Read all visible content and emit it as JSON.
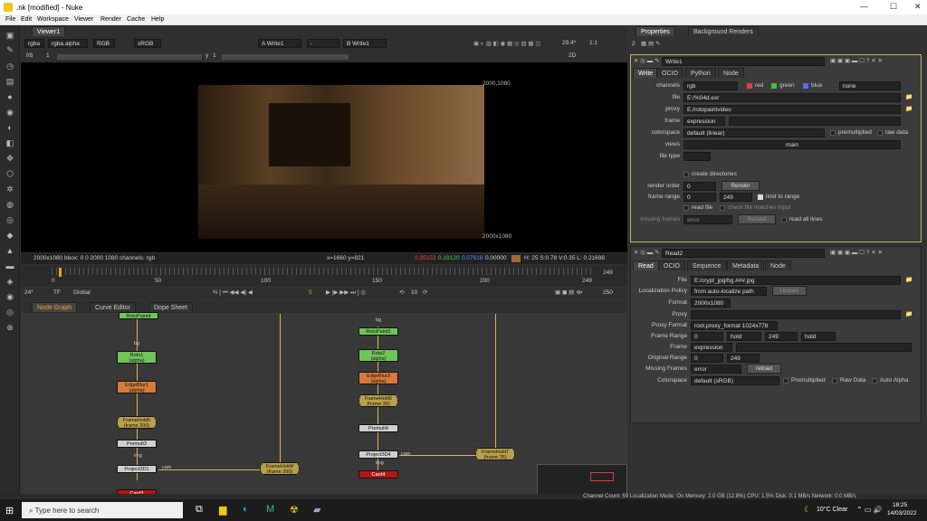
{
  "title": ".nk [modified] - Nuke",
  "menu": [
    "File",
    "Edit",
    "Workspace",
    "Viewer",
    "Render",
    "Cache",
    "Help"
  ],
  "viewer": {
    "tab": "Viewer1",
    "channel": "rgba",
    "alpha": "rgba.alpha",
    "mode": "RGB",
    "lut": "sRGB",
    "inputA": "A  Write1",
    "inputA_op": "-",
    "inputB": "B  Write1",
    "zoom": "29.4*",
    "ratio": "1:1",
    "dim": "2D",
    "fstop": "f/8",
    "frame": "1",
    "y_label": "y",
    "y_val": "1",
    "res_label": "2000,1080",
    "res_label2": "2000x1080",
    "info": "2000x1080  bbox: 0 0 2000 1080 channels: rgb",
    "coords": "x=1660 y=821",
    "r": "0.35153",
    "g": "0.19120",
    "b": "0.07618",
    "a": "0.00000",
    "hsvl": "H: 25 S:0.78 V:0.35  L: 0.21698"
  },
  "timeline": {
    "ticks": [
      "0",
      "50",
      "100",
      "150",
      "200",
      "249"
    ],
    "fps": "24*",
    "tf": "TF",
    "range": "Global",
    "frame": "5",
    "step": "10",
    "end": "250",
    "end_tick": "249"
  },
  "nodegraph": {
    "tabs": [
      "Node Graph",
      "Curve Editor",
      "Dope Sheet"
    ]
  },
  "nodes": {
    "n1": "Roto1\n(alpha)",
    "n2": "EdgeBlur1\n(alpha)",
    "n3": "FrameHold5\n(frame 200)",
    "n4": "Premult3",
    "n5": "Project3D1",
    "n6": "Card3",
    "n7": "RotoPaint5",
    "n8": "Roto2\n(alpha)",
    "n9": "EdgeBlur3\n(alpha)",
    "n10": "FrameHold6\n(frame 35)",
    "n11": "Premult4",
    "n12": "Project3D4",
    "n13": "Card4",
    "n14": "FrameHold4\n(frame 200)",
    "n15": "FrameHold7\n(frame 35)",
    "n16": "RotoPaint4",
    "bg": "bg",
    "img": "img",
    "cam": "cam",
    "img2": "img"
  },
  "properties": {
    "tabs": [
      "Properties",
      "Background Renders"
    ],
    "count": "2",
    "write": {
      "name": "Write1",
      "tabs": [
        "Write",
        "OCIO",
        "Python",
        "Node"
      ],
      "channels_label": "channels",
      "channels": "rgb",
      "red": "red",
      "green": "green",
      "blue": "blue",
      "none": "none",
      "file_label": "file",
      "file": "E:/%04d.exr",
      "proxy_label": "proxy",
      "proxy": "E:/rotopaintvideo",
      "frame_label": "frame",
      "frame": "expression",
      "colorspace_label": "colorspace",
      "colorspace": "default (linear)",
      "premultiplied": "premultiplied",
      "raw": "raw data",
      "views_label": "views",
      "views": "main",
      "filetype_label": "file type",
      "create_dirs": "create directories",
      "render_order_label": "render order",
      "render_order": "0",
      "render_btn": "Render",
      "frame_range_label": "frame range",
      "fr_start": "0",
      "fr_end": "249",
      "limit": "limit to range",
      "read_file": "read file",
      "check_file": "check file matches input",
      "missing_label": "missing frames",
      "missing": "error",
      "reload": "Reload",
      "read_all": "read all lines"
    },
    "read": {
      "name": "Read2",
      "tabs": [
        "Read",
        "OCIO",
        "Sequence",
        "Metadata",
        "Node"
      ],
      "file_label": "File",
      "file": "E:/crypt_jpg/bg.###.jpg",
      "loc_label": "Localization Policy",
      "loc": "from auto-localize path",
      "update": "Update",
      "format_label": "Format",
      "format": "2000x1080",
      "proxy_label": "Proxy",
      "proxyfmt_label": "Proxy Format",
      "proxyfmt": "root.proxy_format 1024x778",
      "range_label": "Frame Range",
      "r_start": "0",
      "r_hold1": "hold",
      "r_end": "249",
      "r_hold2": "hold",
      "frame_label": "Frame",
      "frame": "expression",
      "orig_label": "Original Range",
      "o_start": "0",
      "o_end": "249",
      "missing_label": "Missing Frames",
      "missing": "error",
      "reload": "reload",
      "cs_label": "Colorspace",
      "cs": "default (sRGB)",
      "premult": "Premultiplied",
      "raw": "Raw Data",
      "auto": "Auto Alpha"
    }
  },
  "status": "Channel Count: 59  Localization Mode: On  Memory: 2.0 GB (12.8%)  CPU: 1.5%  Disk: 0.1 MB/s  Network: 0.0 MB/s",
  "taskbar": {
    "search": "Type here to search",
    "weather": "10°C  Clear",
    "time": "18:25",
    "date": "14/03/2022"
  },
  "colors": {
    "accent": "#f0a030",
    "write_border": "#b8b85a",
    "roto": "#6fc45a",
    "edgeblur": "#d67a3a",
    "framehold": "#b9a04a",
    "card": "#b01818",
    "premult": "#cfcfcf"
  }
}
